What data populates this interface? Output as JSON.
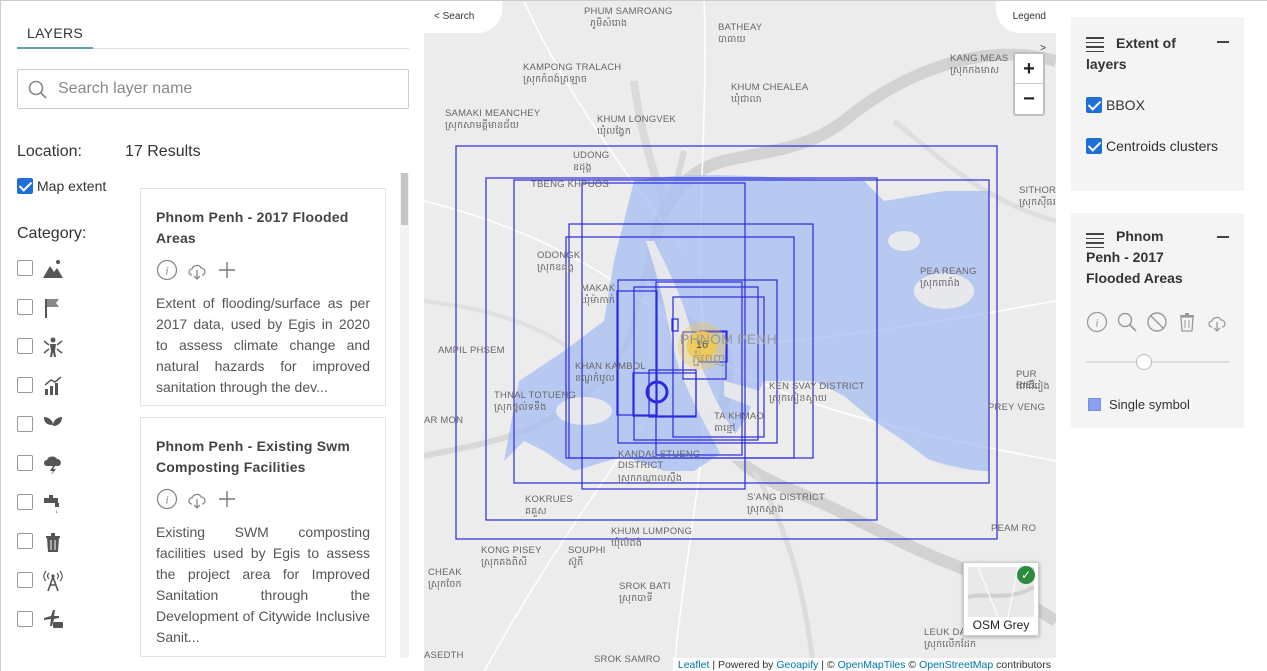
{
  "left_panel": {
    "tab": "LAYERS",
    "search_placeholder": "Search layer name",
    "location_label": "Location:",
    "results": "17 Results",
    "map_extent_label": "Map extent",
    "category_label": "Category:",
    "categories": [
      "mountain-icon",
      "flag-icon",
      "person-icon",
      "bar-chart-icon",
      "leaf-icon",
      "storm-cloud-icon",
      "faucet-icon",
      "trash-icon",
      "antenna-icon",
      "transport-icon"
    ]
  },
  "layers": [
    {
      "title": "Phnom Penh - 2017 Flooded Areas",
      "description": "Extent of flooding/surface as per 2017 data, used by Egis in 2020 to assess climate change and natural hazards for improved sanitation through the dev..."
    },
    {
      "title": "Phnom Penh - Existing Swm Composting Facilities",
      "description": "Existing SWM composting facilities used by Egis to assess the project area for Improved Sanitation through the Development of Citywide Inclusive Sanit..."
    }
  ],
  "map": {
    "search_button": "< Search",
    "legend_button": "Legend >",
    "zoom_in": "+",
    "zoom_out": "−",
    "cluster_count": "16",
    "basemap_label": "OSM Grey",
    "attribution": {
      "leaflet": "Leaflet",
      "powered": " | Powered by ",
      "geoapify": "Geoapify",
      "sep": " | © ",
      "openmaptiles": "OpenMapTiles",
      "sep2": " © ",
      "osm": "OpenStreetMap",
      "contributors": " contributors"
    },
    "places": [
      "PHUM SAMROANG",
      "ភូមិសំរោង",
      "BATHEAY",
      "បាធាយ",
      "KANG MEAS",
      "ស្រុកកងមាស",
      "KAMPONG TRALACH",
      "ស្រុកកំពង់ត្រឡាច",
      "KHUM CHEALEA",
      "ឃុំជាលា",
      "SAMAKI MEANCHEY",
      "ស្រុកសាមគ្គីមានជ័យ",
      "KHUM LONGVEK",
      "ឃុំលង្វែក",
      "UDONG",
      "ឧដុង្គ",
      "TBENG KHPUOS",
      "SITHOR",
      "ស្រុកស៊ីធរ",
      "ODONGK",
      "ស្រុកឧដុង្គ",
      "MAKAK",
      "ឃុំម៉ាកាក់",
      "PEA REANG",
      "ស្រុកពារាំង",
      "AMPIL PHSEM",
      "PHNOM PENH",
      "ភ្នំពេញ",
      "KHAN KAMBOL",
      "ខណ្ឌកំបូល",
      "KEN SVAY DISTRICT",
      "ស្រុកកៀនស្វាយ",
      "PUR RIEL",
      "ពោធិ៍រៀង",
      "THNAL TOTUENG",
      "ស្រុកថ្នល់ទទឹង",
      "TA KHMAO",
      "តាខ្មៅ",
      "AR MON",
      "PREY VENG",
      "KANDAL STUENG DISTRICT",
      "ស្រុកកណ្ដាលស្ទឹង",
      "KOKRUES",
      "គគួស",
      "S'ANG DISTRICT",
      "ស្រុកស្អាង",
      "PEAM RO",
      "KHUM LUMPONG",
      "ឃុំលំពង់",
      "KONG PISEY",
      "ស្រុកគងពិសី",
      "SOUPHI",
      "ស៊ូភី",
      "CHEAK",
      "ស្រុកចែក",
      "SROK BATI",
      "ស្រុកបាទី",
      "LEUK DAEK",
      "ស្រុកលើកដែក",
      "ASEDTH",
      "SROK SAMRO"
    ]
  },
  "right_panel": {
    "extent_title": "Extent of layers",
    "bbox_label": "BBOX",
    "centroids_label": "Centroids clusters",
    "layer_title": "Phnom Penh - 2017 Flooded Areas",
    "symbol_label": "Single symbol",
    "opacity": 0.4
  },
  "colors": {
    "accent": "#1e70d8",
    "bbox": "#2a2ae0",
    "flood": "#a7bdf3",
    "cluster": "#f2c84b",
    "tab_underline": "#5aa4a8"
  }
}
